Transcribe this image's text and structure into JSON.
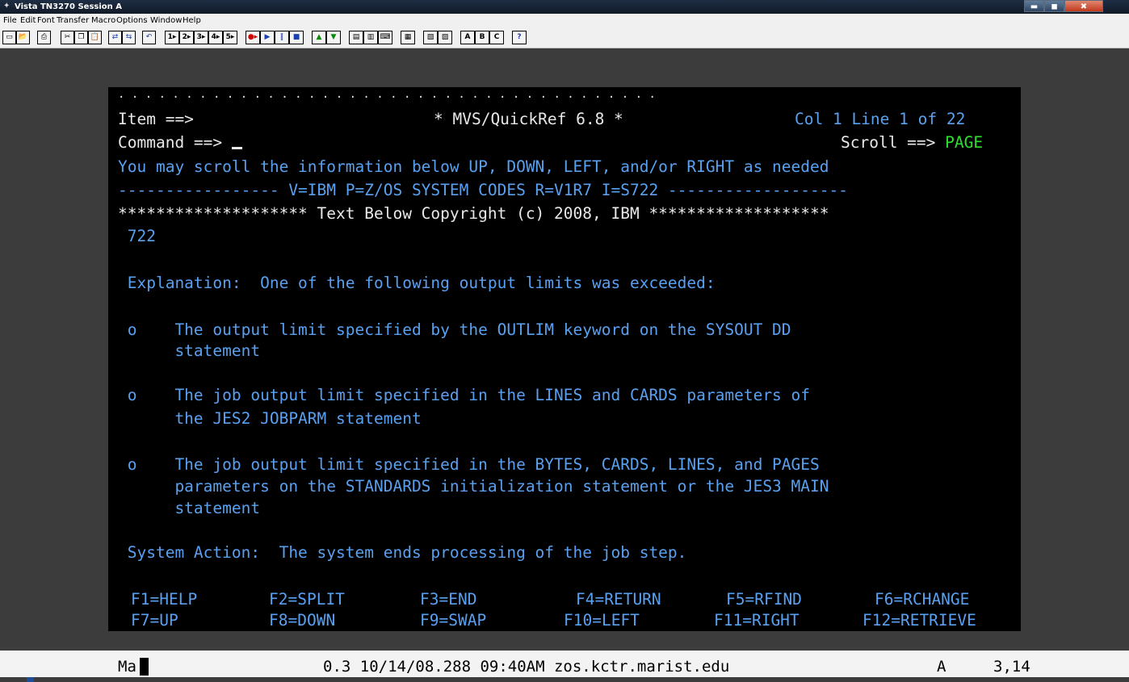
{
  "window": {
    "title": "Vista TN3270 Session A",
    "app_icon": "tn3270-app-icon",
    "controls": {
      "minimize": "▬",
      "maximize": "◼",
      "close": "✖"
    }
  },
  "menubar": [
    "File",
    "Edit",
    "Font",
    "Transfer",
    "Macro",
    "Options",
    "Window",
    "Help"
  ],
  "toolbar": [
    {
      "name": "new-icon",
      "glyph": "▭"
    },
    {
      "name": "open-icon",
      "glyph": "📂"
    },
    {
      "name": "print-icon",
      "glyph": "⎙"
    },
    {
      "name": "cut-icon",
      "glyph": "✂"
    },
    {
      "name": "copy-icon",
      "glyph": "❐"
    },
    {
      "name": "paste-icon",
      "glyph": "📋"
    },
    {
      "name": "connect-icon",
      "glyph": "⇄"
    },
    {
      "name": "disconnect-icon",
      "glyph": "⇆"
    },
    {
      "name": "undo-icon",
      "glyph": "↶"
    },
    {
      "name": "macro-1-icon",
      "glyph": "1▸"
    },
    {
      "name": "macro-2-icon",
      "glyph": "2▸"
    },
    {
      "name": "macro-3-icon",
      "glyph": "3▸"
    },
    {
      "name": "macro-4-icon",
      "glyph": "4▸"
    },
    {
      "name": "macro-5-icon",
      "glyph": "5▸"
    },
    {
      "name": "record-icon",
      "glyph": "●▸"
    },
    {
      "name": "play-icon",
      "glyph": "▶"
    },
    {
      "name": "pause-icon",
      "glyph": "‖"
    },
    {
      "name": "stop-icon",
      "glyph": "■"
    },
    {
      "name": "upload-icon",
      "glyph": "▲"
    },
    {
      "name": "download-icon",
      "glyph": "▼"
    },
    {
      "name": "properties-icon",
      "glyph": "▤"
    },
    {
      "name": "session-list-icon",
      "glyph": "▥"
    },
    {
      "name": "keyboard-map-icon",
      "glyph": "⌨"
    },
    {
      "name": "hotspot-icon",
      "glyph": "▦"
    },
    {
      "name": "screen-copy-icon",
      "glyph": "▧"
    },
    {
      "name": "screen-print-icon",
      "glyph": "▨"
    },
    {
      "name": "session-a-icon",
      "glyph": "A"
    },
    {
      "name": "session-b-icon",
      "glyph": "B"
    },
    {
      "name": "session-c-icon",
      "glyph": "C"
    },
    {
      "name": "help-icon",
      "glyph": "?"
    }
  ],
  "terminal": {
    "dots": ". . . . . . . . . . . . . . . . . . . . . . . . . . . . . . . . . . . . . . . .",
    "item_label": "Item ==>",
    "title": "* MVS/QuickRef 6.8 *",
    "position": "Col 1 Line 1 of 22",
    "command_label": "Command ==>",
    "command_value": "",
    "scroll_label": "Scroll ==>",
    "scroll_value": "PAGE",
    "scroll_hint": "You may scroll the information below UP, DOWN, LEFT, and/or RIGHT as needed",
    "header_line": "----------------- V=IBM P=Z/OS SYSTEM CODES R=V1R7 I=S722 -------------------",
    "copyright_line": "******************** Text Below Copyright (c) 2008, IBM *******************",
    "body": [
      " 722",
      "",
      " Explanation:  One of the following output limits was exceeded:",
      "",
      " o    The output limit specified by the OUTLIM keyword on the SYSOUT DD",
      "      statement",
      "",
      " o    The job output limit specified in the LINES and CARDS parameters of",
      "      the JES2 JOBPARM statement",
      "",
      " o    The job output limit specified in the BYTES, CARDS, LINES, and PAGES",
      "      parameters on the STANDARDS initialization statement or the JES3 MAIN",
      "      statement",
      "",
      " System Action:  The system ends processing of the job step."
    ],
    "fkeys_row1": [
      "F1=HELP",
      "F2=SPLIT",
      "F3=END",
      "F4=RETURN",
      "F5=RFIND",
      "F6=RCHANGE"
    ],
    "fkeys_row2": [
      "F7=UP",
      "F8=DOWN",
      "F9=SWAP",
      "F10=LEFT",
      "F11=RIGHT",
      "F12=RETRIEVE"
    ]
  },
  "status": {
    "indicator": "Ma",
    "session_info": "0.3 10/14/08.288 09:40AM zos.kctr.marist.edu",
    "session_id": "A",
    "cursor_pos": "3,14"
  }
}
